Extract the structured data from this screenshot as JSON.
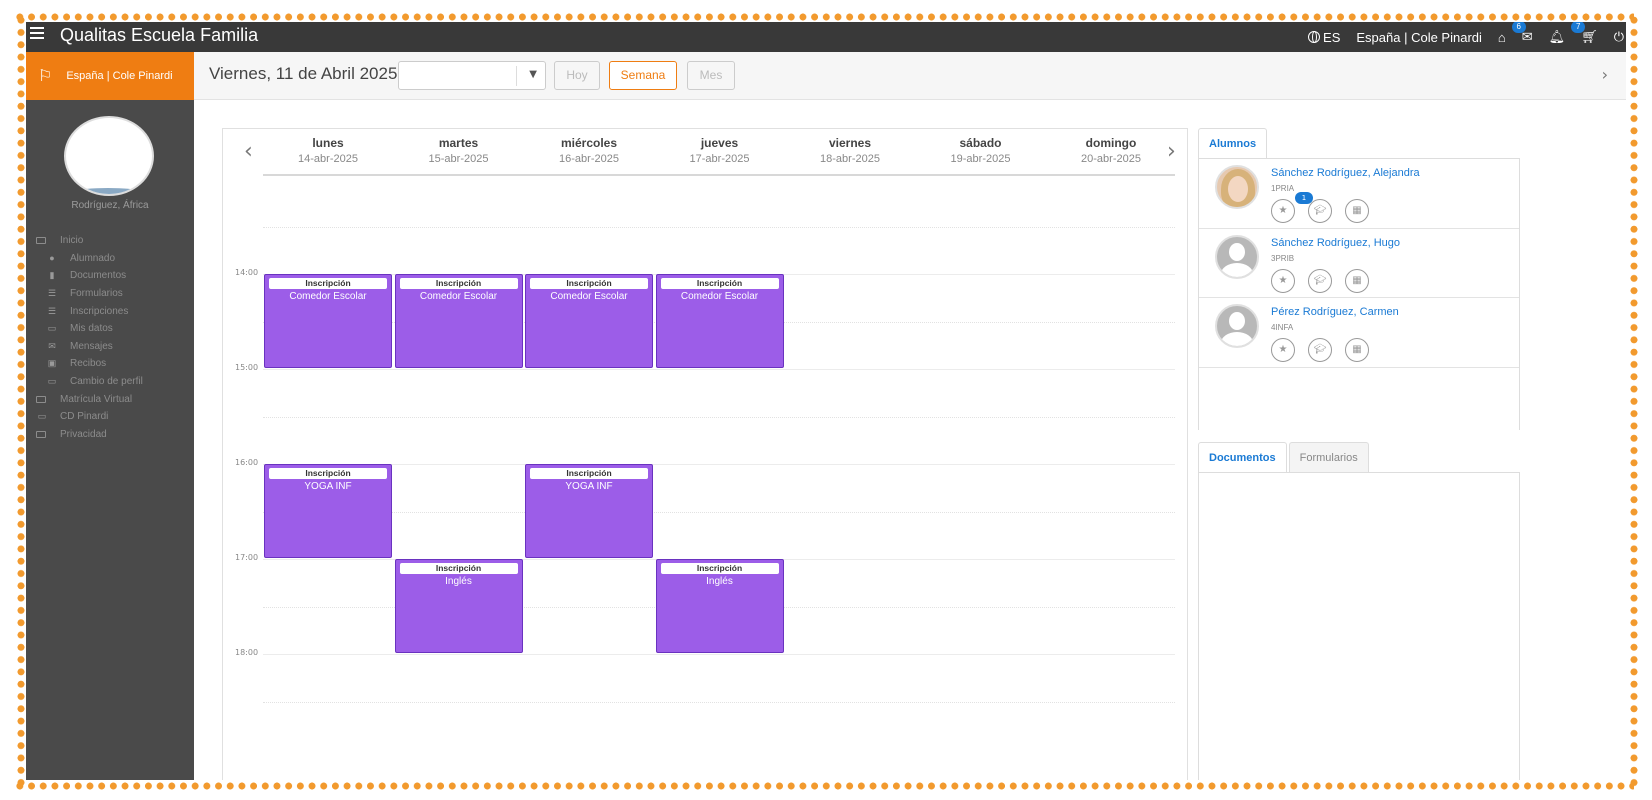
{
  "topbar": {
    "app_title": "Qualitas Escuela Familia",
    "language": "ES",
    "school_context": "España | Cole Pinardi",
    "messages_count": "6",
    "cart_count": "7"
  },
  "sidebar": {
    "school": "España | Cole Pinardi",
    "user_name": "Rodríguez, África",
    "menu": [
      {
        "label": "Inicio",
        "level": "top",
        "icon": "folder-icon"
      },
      {
        "label": "Alumnado",
        "level": "sub",
        "icon": "user-icon"
      },
      {
        "label": "Documentos",
        "level": "sub",
        "icon": "document-icon"
      },
      {
        "label": "Formularios",
        "level": "sub",
        "icon": "list-icon"
      },
      {
        "label": "Inscripciones",
        "level": "sub",
        "icon": "list-icon"
      },
      {
        "label": "Mis datos",
        "level": "sub",
        "icon": "id-card-icon"
      },
      {
        "label": "Mensajes",
        "level": "sub",
        "icon": "envelope-icon"
      },
      {
        "label": "Recibos",
        "level": "sub",
        "icon": "money-icon"
      },
      {
        "label": "Cambio de perfil",
        "level": "sub",
        "icon": "id-card-icon"
      },
      {
        "label": "Matrícula Virtual",
        "level": "top",
        "icon": "folder-icon"
      },
      {
        "label": "CD Pinardi",
        "level": "top",
        "icon": "id-card-icon"
      },
      {
        "label": "Privacidad",
        "level": "top",
        "icon": "folder-icon"
      }
    ]
  },
  "header": {
    "date_title": "Viernes, 11 de Abril 2025",
    "select_value": "",
    "btn_today": "Hoy",
    "btn_week": "Semana",
    "btn_month": "Mes"
  },
  "calendar": {
    "days": [
      {
        "name": "lunes",
        "date": "14-abr-2025"
      },
      {
        "name": "martes",
        "date": "15-abr-2025"
      },
      {
        "name": "miércoles",
        "date": "16-abr-2025"
      },
      {
        "name": "jueves",
        "date": "17-abr-2025"
      },
      {
        "name": "viernes",
        "date": "18-abr-2025"
      },
      {
        "name": "sábado",
        "date": "19-abr-2025"
      },
      {
        "name": "domingo",
        "date": "20-abr-2025"
      }
    ],
    "hours": [
      "14:00",
      "15:00",
      "16:00",
      "17:00",
      "18:00"
    ],
    "events": [
      {
        "day": 0,
        "start": "14:00",
        "end": "15:00",
        "tag": "Inscripción",
        "name": "Comedor Escolar"
      },
      {
        "day": 1,
        "start": "14:00",
        "end": "15:00",
        "tag": "Inscripción",
        "name": "Comedor Escolar"
      },
      {
        "day": 2,
        "start": "14:00",
        "end": "15:00",
        "tag": "Inscripción",
        "name": "Comedor Escolar"
      },
      {
        "day": 3,
        "start": "14:00",
        "end": "15:00",
        "tag": "Inscripción",
        "name": "Comedor Escolar"
      },
      {
        "day": 0,
        "start": "16:00",
        "end": "17:00",
        "tag": "Inscripción",
        "name": "YOGA INF"
      },
      {
        "day": 2,
        "start": "16:00",
        "end": "17:00",
        "tag": "Inscripción",
        "name": "YOGA INF"
      },
      {
        "day": 1,
        "start": "17:00",
        "end": "18:00",
        "tag": "Inscripción",
        "name": "Inglés"
      },
      {
        "day": 3,
        "start": "17:00",
        "end": "18:00",
        "tag": "Inscripción",
        "name": "Inglés"
      }
    ],
    "event_color": "#9c5de8"
  },
  "students_tab": {
    "label": "Alumnos"
  },
  "students": [
    {
      "name": "Sánchez Rodríguez, Alejandra",
      "class": "1PRIA",
      "photo": true,
      "badge": "1"
    },
    {
      "name": "Sánchez Rodríguez, Hugo",
      "class": "3PRIB",
      "photo": false,
      "badge": ""
    },
    {
      "name": "Pérez Rodríguez, Carmen",
      "class": "4INFA",
      "photo": false,
      "badge": ""
    }
  ],
  "docs_tabs": [
    {
      "label": "Documentos",
      "active": true
    },
    {
      "label": "Formularios",
      "active": false
    }
  ],
  "colors": {
    "accent": "#ef7d12",
    "link": "#1a7ad4",
    "sidebar": "#4a4a4a",
    "topbar": "#393939"
  }
}
